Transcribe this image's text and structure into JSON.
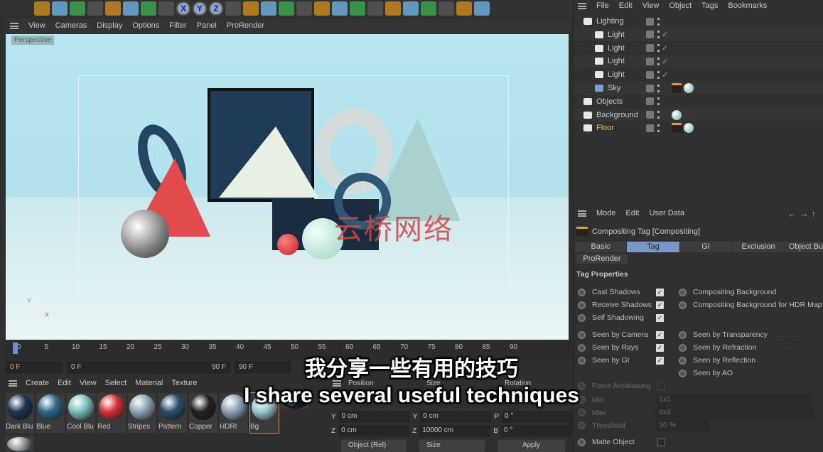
{
  "toolbar": {
    "icons": [
      "undo-icon",
      "redo-icon",
      "select-icon",
      "move-icon",
      "scale-icon",
      "rotate-icon",
      "recent-icon",
      "add-icon",
      "x-axis-icon",
      "y-axis-icon",
      "z-axis-icon",
      "coordinate-system-icon",
      "render-view-icon",
      "render-picture-icon",
      "render-settings-icon",
      "cube-icon",
      "pen-icon",
      "subdivision-icon",
      "extrude-icon",
      "cloner-icon",
      "mograph-icon",
      "deformer-icon",
      "bend-icon",
      "floor-icon",
      "camera-icon",
      "light-icon"
    ],
    "x": "X",
    "y": "Y",
    "z": "Z"
  },
  "viewport": {
    "menu": [
      "View",
      "Cameras",
      "Display",
      "Options",
      "Filter",
      "Panel",
      "ProRender"
    ],
    "label": "Perspective",
    "axis_y": "Y",
    "axis_x": "X"
  },
  "watermark": "云桥网络",
  "timeline": {
    "ticks": [
      "0",
      "5",
      "10",
      "15",
      "20",
      "25",
      "30",
      "35",
      "40",
      "45",
      "50",
      "55",
      "60",
      "65",
      "70",
      "75",
      "80",
      "85",
      "90"
    ],
    "current": "0 F",
    "start": "0 F",
    "range_start": "0 F",
    "range_end": "90 F",
    "end": "90 F",
    "end_frame": "0 F"
  },
  "materials": {
    "menu": [
      "Create",
      "Edit",
      "View",
      "Select",
      "Material",
      "Texture"
    ],
    "items": [
      {
        "name": "Dark Blu",
        "color": "#1d3550"
      },
      {
        "name": "Blue",
        "color": "#2f6a8c"
      },
      {
        "name": "Cool Blu",
        "color": "#7cc0bf"
      },
      {
        "name": "Red",
        "color": "#d8303a"
      },
      {
        "name": "Stripes",
        "color": "#8fa6b4"
      },
      {
        "name": "Pattern",
        "color": "#2a4f6e"
      },
      {
        "name": "Copper",
        "color": "#222222"
      },
      {
        "name": "HDRI",
        "color": "#8ea4b8"
      },
      {
        "name": "Bg",
        "color": "#9cc9d4"
      },
      {
        "name": "",
        "color": "#0f1a2a"
      },
      {
        "name": "",
        "color": "#9aa3aa"
      }
    ]
  },
  "coords": {
    "headers": [
      "Position",
      "Size",
      "Rotation"
    ],
    "rows": [
      {
        "a": "Y",
        "pos": "0 cm",
        "b": "Y",
        "size": "0 cm",
        "c": "P",
        "rot": "0 °"
      },
      {
        "a": "Z",
        "pos": "0 cm",
        "b": "Z",
        "size": "10000 cm",
        "c": "B",
        "rot": "0 °"
      }
    ],
    "mode": "Object (Rel)",
    "size_mode": "Size",
    "apply": "Apply"
  },
  "objects": {
    "menu": [
      "File",
      "Edit",
      "View",
      "Object",
      "Tags",
      "Bookmarks"
    ],
    "rows": [
      {
        "name": "Lighting",
        "indent": 0,
        "check": false
      },
      {
        "name": "Light",
        "indent": 1,
        "check": true
      },
      {
        "name": "Light",
        "indent": 1,
        "check": true
      },
      {
        "name": "Light",
        "indent": 1,
        "check": true
      },
      {
        "name": "Light",
        "indent": 1,
        "check": true
      },
      {
        "name": "Sky",
        "indent": 1,
        "check": false
      },
      {
        "name": "Objects",
        "indent": 0,
        "check": false
      },
      {
        "name": "Background",
        "indent": 0,
        "check": false
      },
      {
        "name": "Floor",
        "indent": 0,
        "check": false,
        "selected": true
      }
    ]
  },
  "attributes": {
    "menu": [
      "Mode",
      "Edit",
      "User Data"
    ],
    "title": "Compositing Tag [Compositing]",
    "tabs": [
      "Basic",
      "Tag",
      "GI",
      "Exclusion",
      "Object Bu"
    ],
    "active_tab": "Tag",
    "tab2": "ProRender",
    "section": "Tag Properties",
    "left": [
      {
        "label": "Cast Shadows",
        "checked": true
      },
      {
        "label": "Receive Shadows",
        "checked": true
      },
      {
        "label": "Self Shadowing",
        "checked": true
      },
      {
        "label": "Seen by Camera",
        "checked": true
      },
      {
        "label": "Seen by Rays",
        "checked": true
      },
      {
        "label": "Seen by GI",
        "checked": true
      }
    ],
    "right": [
      "Compositing Background",
      "Compositing Background for HDR Map",
      "Seen by Transparency",
      "Seen by Refraction",
      "Seen by Reflection",
      "Seen by AO"
    ],
    "force_aa": "Force Antialiasing",
    "min_label": "Min",
    "min": "1x1",
    "max_label": "Max",
    "max": "4x4",
    "threshold_label": "Threshold",
    "threshold": "10 %",
    "matte": "Matte Object"
  },
  "subtitles": {
    "zh": "我分享一些有用的技巧",
    "en": "I share several useful techniques"
  }
}
